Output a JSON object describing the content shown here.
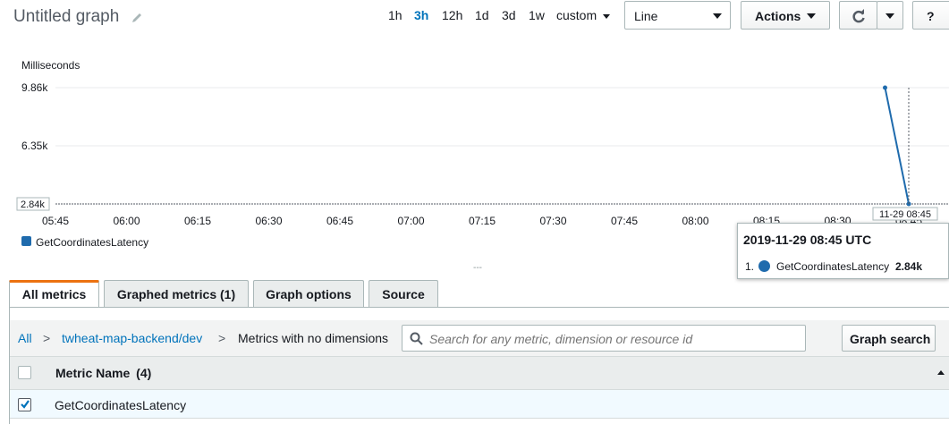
{
  "header": {
    "title": "Untitled graph",
    "ranges": [
      "1h",
      "3h",
      "12h",
      "1d",
      "3d",
      "1w"
    ],
    "active_range": "3h",
    "custom_label": "custom",
    "chart_type_value": "Line",
    "actions_label": "Actions",
    "refresh_icon": "refresh-icon",
    "help_label": "?"
  },
  "chart_data": {
    "type": "line",
    "ylabel": "Milliseconds",
    "y_ticks": [
      "9.86k",
      "6.35k",
      "2.84k"
    ],
    "x_ticks": [
      "05:45",
      "06:00",
      "06:15",
      "06:30",
      "06:45",
      "07:00",
      "07:15",
      "07:30",
      "07:45",
      "08:00",
      "08:15",
      "08:30",
      "08:45"
    ],
    "series": [
      {
        "name": "GetCoordinatesLatency",
        "color": "#1f6bad",
        "x": [
          "08:40",
          "08:45"
        ],
        "values": [
          9860,
          2840
        ]
      }
    ],
    "ylim": [
      2840,
      9860
    ],
    "hover_x_label": "11-29 08:45",
    "legend_placement": "bottom-left",
    "legend": [
      "GetCoordinatesLatency"
    ],
    "tooltip": {
      "time": "2019-11-29 08:45 UTC",
      "index": "1.",
      "metric": "GetCoordinatesLatency",
      "value": "2.84k"
    }
  },
  "resize_handle": "---",
  "tabs": [
    {
      "label": "All metrics",
      "active": true
    },
    {
      "label": "Graphed metrics (1)",
      "active": false
    },
    {
      "label": "Graph options",
      "active": false
    },
    {
      "label": "Source",
      "active": false
    }
  ],
  "breadcrumb": {
    "all": "All",
    "sep": ">",
    "namespace": "twheat-map-backend/dev",
    "current": "Metrics with no dimensions"
  },
  "search": {
    "placeholder": "Search for any metric, dimension or resource id",
    "button": "Graph search"
  },
  "table": {
    "header": "Metric Name",
    "count": "(4)",
    "rows": [
      {
        "name": "GetCoordinatesLatency",
        "checked": true
      }
    ]
  }
}
